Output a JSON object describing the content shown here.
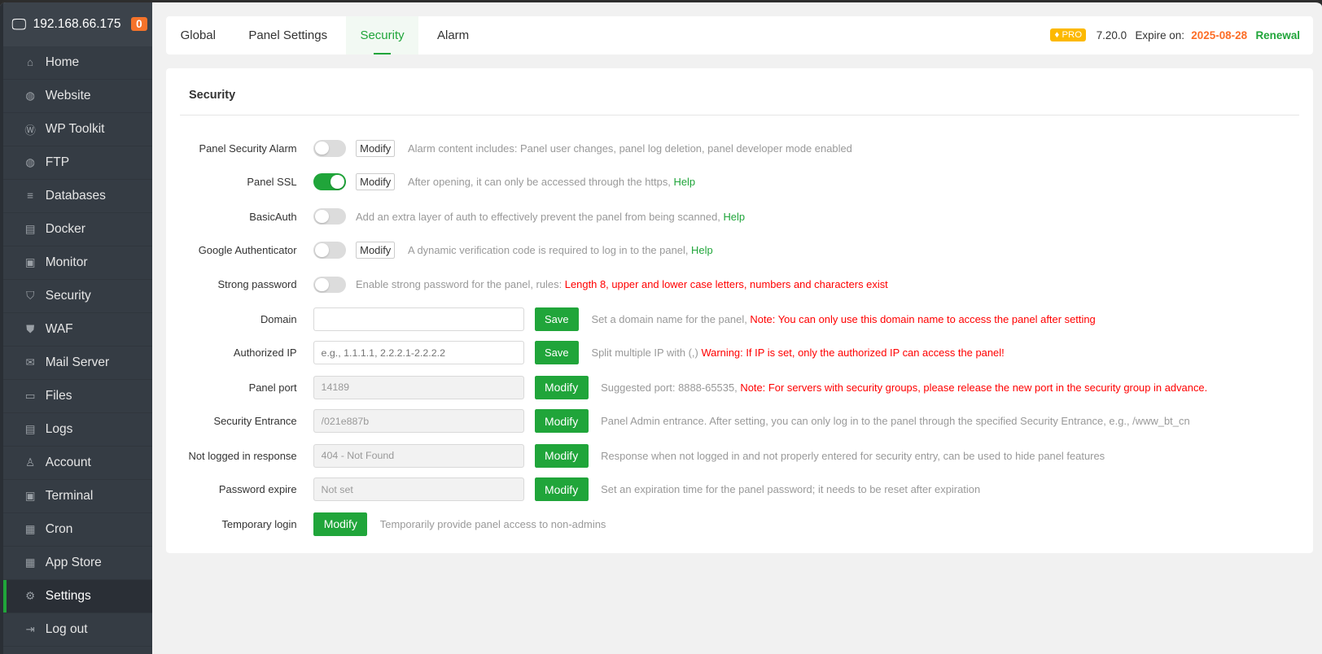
{
  "sidebar": {
    "ip": "192.168.66.175",
    "badge": "0",
    "items": [
      {
        "label": "Home",
        "icon": "⌂"
      },
      {
        "label": "Website",
        "icon": "◍"
      },
      {
        "label": "WP Toolkit",
        "icon": "Ⓦ"
      },
      {
        "label": "FTP",
        "icon": "◍"
      },
      {
        "label": "Databases",
        "icon": "≡"
      },
      {
        "label": "Docker",
        "icon": "▤"
      },
      {
        "label": "Monitor",
        "icon": "▣"
      },
      {
        "label": "Security",
        "icon": "⛉"
      },
      {
        "label": "WAF",
        "icon": "⛊"
      },
      {
        "label": "Mail Server",
        "icon": "✉"
      },
      {
        "label": "Files",
        "icon": "▭"
      },
      {
        "label": "Logs",
        "icon": "▤"
      },
      {
        "label": "Account",
        "icon": "♙"
      },
      {
        "label": "Terminal",
        "icon": "▣"
      },
      {
        "label": "Cron",
        "icon": "▦"
      },
      {
        "label": "App Store",
        "icon": "▦"
      },
      {
        "label": "Settings",
        "icon": "⚙"
      },
      {
        "label": "Log out",
        "icon": "⇥"
      }
    ]
  },
  "tabs": [
    "Global",
    "Panel Settings",
    "Security",
    "Alarm"
  ],
  "header": {
    "pro": "PRO",
    "version": "7.20.0",
    "expire_label": "Expire on:",
    "expire_date": "2025-08-28",
    "renewal": "Renewal"
  },
  "section_title": "Security",
  "rows": {
    "alarm": {
      "label": "Panel Security Alarm",
      "btn": "Modify",
      "desc": "Alarm content includes: Panel user changes, panel log deletion, panel developer mode enabled"
    },
    "ssl": {
      "label": "Panel SSL",
      "btn": "Modify",
      "desc": "After opening, it can only be accessed through the https,",
      "help": "Help"
    },
    "basic": {
      "label": "BasicAuth",
      "desc": "Add an extra layer of auth to effectively prevent the panel from being scanned,",
      "help": "Help"
    },
    "ga": {
      "label": "Google Authenticator",
      "btn": "Modify",
      "desc": "A dynamic verification code is required to log in to the panel,",
      "help": "Help"
    },
    "strong": {
      "label": "Strong password",
      "desc": "Enable strong password for the panel, rules:",
      "note": "Length 8, upper and lower case letters, numbers and characters exist"
    },
    "domain": {
      "label": "Domain",
      "value": "",
      "btn": "Save",
      "desc": "Set a domain name for the panel,",
      "note": "Note: You can only use this domain name to access the panel after setting"
    },
    "ip": {
      "label": "Authorized IP",
      "placeholder": "e.g., 1.1.1.1, 2.2.2.1-2.2.2.2",
      "btn": "Save",
      "desc": "Split multiple IP with (,)",
      "note": "Warning: If IP is set, only the authorized IP can access the panel!"
    },
    "port": {
      "label": "Panel port",
      "value": "14189",
      "btn": "Modify",
      "desc": "Suggested port: 8888-65535,",
      "note": "Note: For servers with security groups, please release the new port in the security group in advance."
    },
    "entrance": {
      "label": "Security Entrance",
      "value": "/021e887b",
      "btn": "Modify",
      "desc": "Panel Admin entrance. After setting, you can only log in to the panel through the specified Security Entrance, e.g., /www_bt_cn"
    },
    "response": {
      "label": "Not logged in response",
      "value": "404 - Not Found",
      "btn": "Modify",
      "desc": "Response when not logged in and not properly entered for security entry, can be used to hide panel features"
    },
    "pwexpire": {
      "label": "Password expire",
      "value": "Not set",
      "btn": "Modify",
      "desc": "Set an expiration time for the panel password; it needs to be reset after expiration"
    },
    "temp": {
      "label": "Temporary login",
      "btn": "Modify",
      "desc": "Temporarily provide panel access to non-admins"
    }
  },
  "toggles": {
    "alarm": false,
    "ssl": true,
    "basic": false,
    "ga": false,
    "strong": false
  },
  "colors": {
    "accent": "#20a53a",
    "warn": "#ff0000",
    "expire": "#fc6d26"
  }
}
